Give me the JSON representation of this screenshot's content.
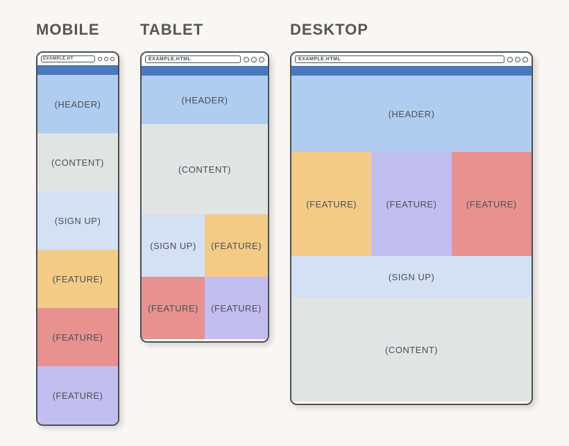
{
  "labels": {
    "mobile": "MOBILE",
    "tablet": "TABLET",
    "desktop": "DESKTOP"
  },
  "url": {
    "mobile": "EXAMPLE.HT",
    "tablet": "EXAMPLE.HTML",
    "desktop": "EXAMPLE.HTML"
  },
  "sections": {
    "header": "(HEADER)",
    "content": "(CONTENT)",
    "signup": "(SIGN UP)",
    "feature": "(FEATURE)"
  }
}
